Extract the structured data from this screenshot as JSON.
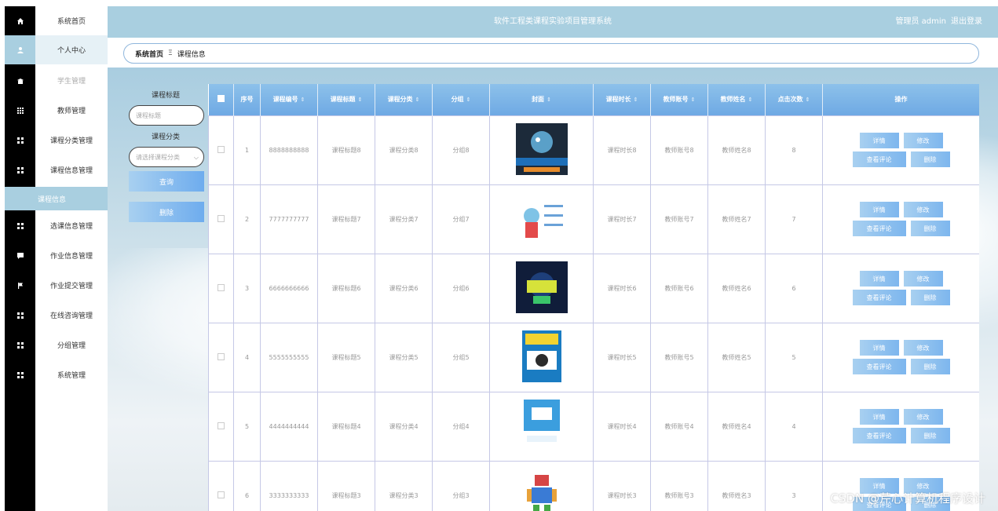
{
  "header": {
    "title": "软件工程类课程实验项目管理系统",
    "role": "管理员 admin",
    "logout": "退出登录"
  },
  "sidebar": {
    "items": [
      {
        "label": "系统首页",
        "icon": "home-icon"
      },
      {
        "label": "个人中心",
        "icon": "user-icon"
      },
      {
        "label": "学生管理",
        "icon": "student-icon"
      },
      {
        "label": "教师管理",
        "icon": "grid-icon"
      },
      {
        "label": "课程分类管理",
        "icon": "grid-icon"
      },
      {
        "label": "课程信息管理",
        "icon": "grid-icon"
      },
      {
        "label": "选课信息管理",
        "icon": "grid-icon"
      },
      {
        "label": "作业信息管理",
        "icon": "message-icon"
      },
      {
        "label": "作业提交管理",
        "icon": "flag-icon"
      },
      {
        "label": "在线咨询管理",
        "icon": "grid-icon"
      },
      {
        "label": "分组管理",
        "icon": "grid-icon"
      },
      {
        "label": "系统管理",
        "icon": "grid-icon"
      }
    ],
    "sub_item": "课程信息"
  },
  "breadcrumb": {
    "home": "系统首页",
    "separator": "Ξ",
    "current": "课程信息"
  },
  "filters": {
    "title_label": "课程标题",
    "title_placeholder": "课程标题",
    "category_label": "课程分类",
    "category_placeholder": "请选择课程分类",
    "search_button": "查询",
    "delete_button": "删除"
  },
  "table": {
    "columns": [
      "序号",
      "课程编号",
      "课程标题",
      "课程分类",
      "分组",
      "封面",
      "课程时长",
      "教师账号",
      "教师姓名",
      "点击次数",
      "操作"
    ],
    "rows": [
      {
        "no": "1",
        "code": "8888888888",
        "title": "课程标题8",
        "category": "课程分类8",
        "group": "分组8",
        "duration": "课程时长8",
        "teacher_account": "教师账号8",
        "teacher_name": "教师姓名8",
        "clicks": "8"
      },
      {
        "no": "2",
        "code": "7777777777",
        "title": "课程标题7",
        "category": "课程分类7",
        "group": "分组7",
        "duration": "课程时长7",
        "teacher_account": "教师账号7",
        "teacher_name": "教师姓名7",
        "clicks": "7"
      },
      {
        "no": "3",
        "code": "6666666666",
        "title": "课程标题6",
        "category": "课程分类6",
        "group": "分组6",
        "duration": "课程时长6",
        "teacher_account": "教师账号6",
        "teacher_name": "教师姓名6",
        "clicks": "6"
      },
      {
        "no": "4",
        "code": "5555555555",
        "title": "课程标题5",
        "category": "课程分类5",
        "group": "分组5",
        "duration": "课程时长5",
        "teacher_account": "教师账号5",
        "teacher_name": "教师姓名5",
        "clicks": "5"
      },
      {
        "no": "5",
        "code": "4444444444",
        "title": "课程标题4",
        "category": "课程分类4",
        "group": "分组4",
        "duration": "课程时长4",
        "teacher_account": "教师账号4",
        "teacher_name": "教师姓名4",
        "clicks": "4"
      },
      {
        "no": "6",
        "code": "3333333333",
        "title": "课程标题3",
        "category": "课程分类3",
        "group": "分组3",
        "duration": "课程时长3",
        "teacher_account": "教师账号3",
        "teacher_name": "教师姓名3",
        "clicks": "3"
      }
    ],
    "ops": {
      "detail": "详情",
      "edit": "修改",
      "comments": "查看评论",
      "delete": "删除"
    }
  },
  "watermark": "CSDN @芹心计算机程序设计",
  "colors": {
    "accent": "#a9cfe0",
    "button": "#7db6ee",
    "sidebar_icons": "#000000"
  }
}
